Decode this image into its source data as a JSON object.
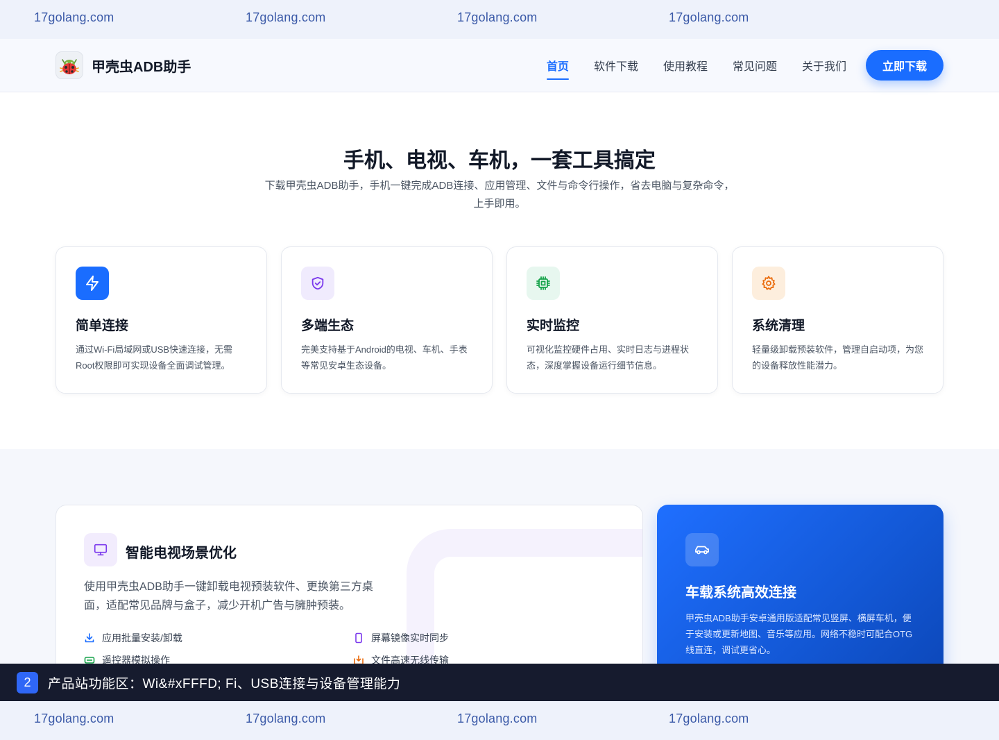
{
  "watermark": {
    "text": "17golang.com"
  },
  "nav": {
    "brand": "甲壳虫ADB助手",
    "links": [
      "首页",
      "软件下载",
      "使用教程",
      "常见问题",
      "关于我们"
    ],
    "cta": "立即下载"
  },
  "hero": {
    "title": "手机、电视、车机，一套工具搞定",
    "subtitle": "下载甲壳虫ADB助手，手机一键完成ADB连接、应用管理、文件与命令行操作，省去电脑与复杂命令，上手即用。"
  },
  "features": [
    {
      "icon": "lightning-icon",
      "title": "简单连接",
      "desc": "通过Wi-Fi局域网或USB快速连接，无需Root权限即可实现设备全面调试管理。"
    },
    {
      "icon": "shield-check-icon",
      "title": "多端生态",
      "desc": "完美支持基于Android的电视、车机、手表等常见安卓生态设备。"
    },
    {
      "icon": "chip-icon",
      "title": "实时监控",
      "desc": "可视化监控硬件占用、实时日志与进程状态，深度掌握设备运行细节信息。"
    },
    {
      "icon": "gear-icon",
      "title": "系统清理",
      "desc": "轻量级卸载预装软件，管理自启动项，为您的设备释放性能潜力。"
    }
  ],
  "tv": {
    "icon": "monitor-icon",
    "title": "智能电视场景优化",
    "desc": "使用甲壳虫ADB助手一键卸载电视预装软件、更换第三方桌面，适配常见品牌与盒子，减少开机广告与臃肿预装。",
    "features": [
      {
        "icon": "download-icon",
        "label": "应用批量安装/卸载"
      },
      {
        "icon": "phone-icon",
        "label": "屏幕镜像实时同步"
      },
      {
        "icon": "remote-icon",
        "label": "遥控器模拟操作"
      },
      {
        "icon": "transfer-icon",
        "label": "文件高速无线传输"
      }
    ]
  },
  "car": {
    "icon": "car-icon",
    "title": "车载系统高效连接",
    "desc": "甲壳虫ADB助手安卓通用版适配常见竖屏、横屏车机，便于安装或更新地图、音乐等应用。网络不稳时可配合OTG线直连，调试更省心。"
  },
  "caption": {
    "number": "2",
    "text": "产品站功能区：Wi&#xFFFD; Fi、USB连接与设备管理能力"
  },
  "colors": {
    "primary": "#1a6dff",
    "dark_bar": "#161b2e",
    "watermark": "#3b5aa8"
  }
}
